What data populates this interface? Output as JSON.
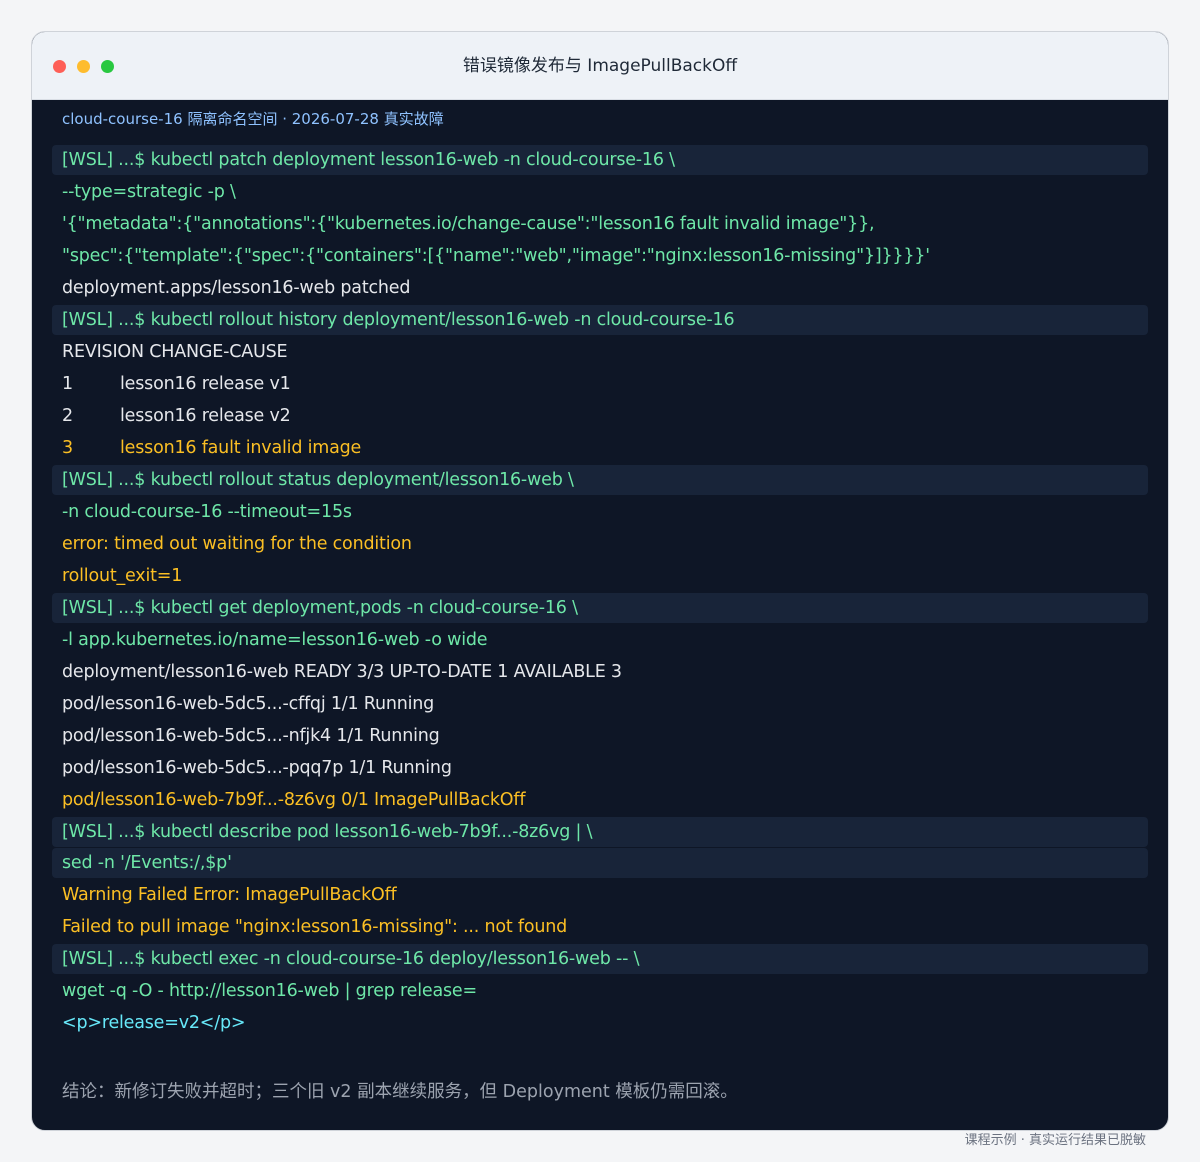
{
  "window": {
    "title": "错误镜像发布与 ImagePullBackOff",
    "meta": "cloud-course-16 隔离命名空间 · 2026-07-28 真实故障"
  },
  "terminal": {
    "lines": [
      "[WSL] ...$ kubectl patch deployment lesson16-web -n cloud-course-16 \\",
      "--type=strategic -p \\",
      "'{\"metadata\":{\"annotations\":{\"kubernetes.io/change-cause\":\"lesson16 fault invalid image\"}},",
      "\"spec\":{\"template\":{\"spec\":{\"containers\":[{\"name\":\"web\",\"image\":\"nginx:lesson16-missing\"}]}}}}'",
      "deployment.apps/lesson16-web patched",
      "[WSL] ...$ kubectl rollout history deployment/lesson16-web -n cloud-course-16",
      "REVISION  CHANGE-CAUSE",
      "[WSL] ...$ kubectl rollout status deployment/lesson16-web \\",
      "-n cloud-course-16 --timeout=15s",
      "error: timed out waiting for the condition",
      "rollout_exit=1",
      "[WSL] ...$ kubectl get deployment,pods -n cloud-course-16 \\",
      "-l app.kubernetes.io/name=lesson16-web -o wide",
      "deployment/lesson16-web  READY 3/3  UP-TO-DATE 1  AVAILABLE 3",
      "pod/lesson16-web-5dc5...-cffqj  1/1  Running",
      "pod/lesson16-web-5dc5...-nfjk4  1/1  Running",
      "pod/lesson16-web-5dc5...-pqq7p  1/1  Running",
      "pod/lesson16-web-7b9f...-8z6vg  0/1  ImagePullBackOff",
      "[WSL] ...$ kubectl describe pod lesson16-web-7b9f...-8z6vg | \\",
      "sed -n '/Events:/,$p'",
      "Warning  Failed  Error: ImagePullBackOff",
      "Failed to pull image \"nginx:lesson16-missing\": ... not found",
      "[WSL] ...$ kubectl exec -n cloud-course-16 deploy/lesson16-web -- \\",
      "wget -q -O - http://lesson16-web | grep release=",
      "<p>release=v2</p>"
    ],
    "history": [
      {
        "rev": "1",
        "cause": "lesson16 release v1"
      },
      {
        "rev": "2",
        "cause": "lesson16 release v2"
      },
      {
        "rev": "3",
        "cause": "lesson16 fault invalid image"
      }
    ]
  },
  "conclusion": "结论：新修订失败并超时；三个旧 v2 副本继续服务，但 Deployment 模板仍需回滚。",
  "footer": "课程示例 · 真实运行结果已脱敏",
  "colors": {
    "command": "#6ee7a8",
    "output": "#e5e7eb",
    "warning": "#fbbf24",
    "info": "#67e8f9",
    "terminal_bg": "#0e1626"
  }
}
